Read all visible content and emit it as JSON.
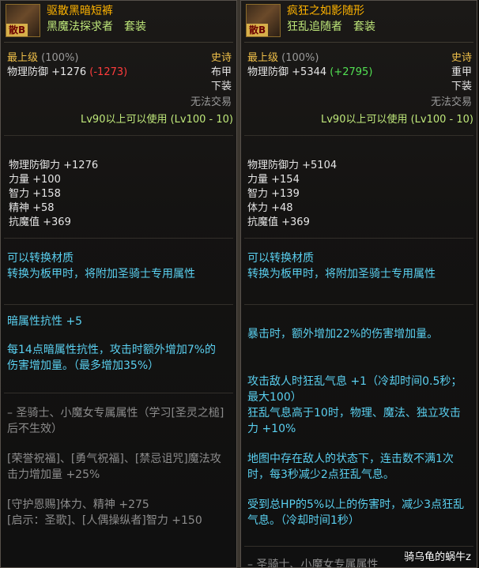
{
  "left": {
    "badge": "散",
    "grade": "B",
    "title": "驱散黑暗短裤",
    "subtitle": "黑魔法探求者　套装",
    "tier": "最上级",
    "percent": "(100%)",
    "rarity": "史诗",
    "defense_label": "物理防御",
    "defense_value": "+1276",
    "defense_diff": "(-1273)",
    "armor_type": "布甲",
    "slot": "下装",
    "trade": "无法交易",
    "level_req": "Lv90以上可以使用 (Lv100 - 10)",
    "stats": [
      "物理防御力 +1276",
      "力量 +100",
      "智力 +158",
      "精神 +58",
      "抗魔值 +369"
    ],
    "convert_title": "可以转换材质",
    "convert_desc": "转换为板甲时，将附加圣骑士专用属性",
    "element_stat": "暗属性抗性 +5",
    "element_desc": "每14点暗属性抗性，攻击时额外增加7%的伤害增加量。（最多增加35%）",
    "class_title": "– 圣骑士、小魔女专属属性（学习[圣灵之槌]后不生效）",
    "class_lines": [
      "[荣誉祝福]、[勇气祝福]、[禁忌诅咒]魔法攻击力增加量 +25%",
      "[守护恩赐]体力、精神 +275",
      "[启示：圣歌]、[人偶操纵者]智力 +150"
    ]
  },
  "right": {
    "badge": "散",
    "grade": "B",
    "title": "疯狂之如影随形",
    "subtitle": "狂乱追随者　套装",
    "tier": "最上级",
    "percent": "(100%)",
    "rarity": "史诗",
    "defense_label": "物理防御",
    "defense_value": "+5344",
    "defense_diff": "(+2795)",
    "armor_type": "重甲",
    "slot": "下装",
    "trade": "无法交易",
    "level_req": "Lv90以上可以使用 (Lv100 - 10)",
    "stats": [
      "物理防御力 +5104",
      "力量 +154",
      "智力 +139",
      "体力 +48",
      "抗魔值 +369"
    ],
    "convert_title": "可以转换材质",
    "convert_desc": "转换为板甲时，将附加圣骑士专用属性",
    "crit_desc": "暴击时，额外增加22%的伤害增加量。",
    "frenzy_desc": "攻击敌人时狂乱气息 +1（冷却时间0.5秒；最大100）",
    "frenzy_effect": "狂乱气息高于10时，物理、魔法、独立攻击力 +10%",
    "map_desc": "地图中存在敌人的状态下，连击数不满1次时，每3秒减少2点狂乱气息。",
    "damage_desc": "受到总HP的5%以上的伤害时，减少3点狂乱气息。（冷却时间1秒）",
    "class_title_partial": "– 圣骑士、小魔女专属属性"
  },
  "watermark": "骑乌龟的蜗牛z"
}
